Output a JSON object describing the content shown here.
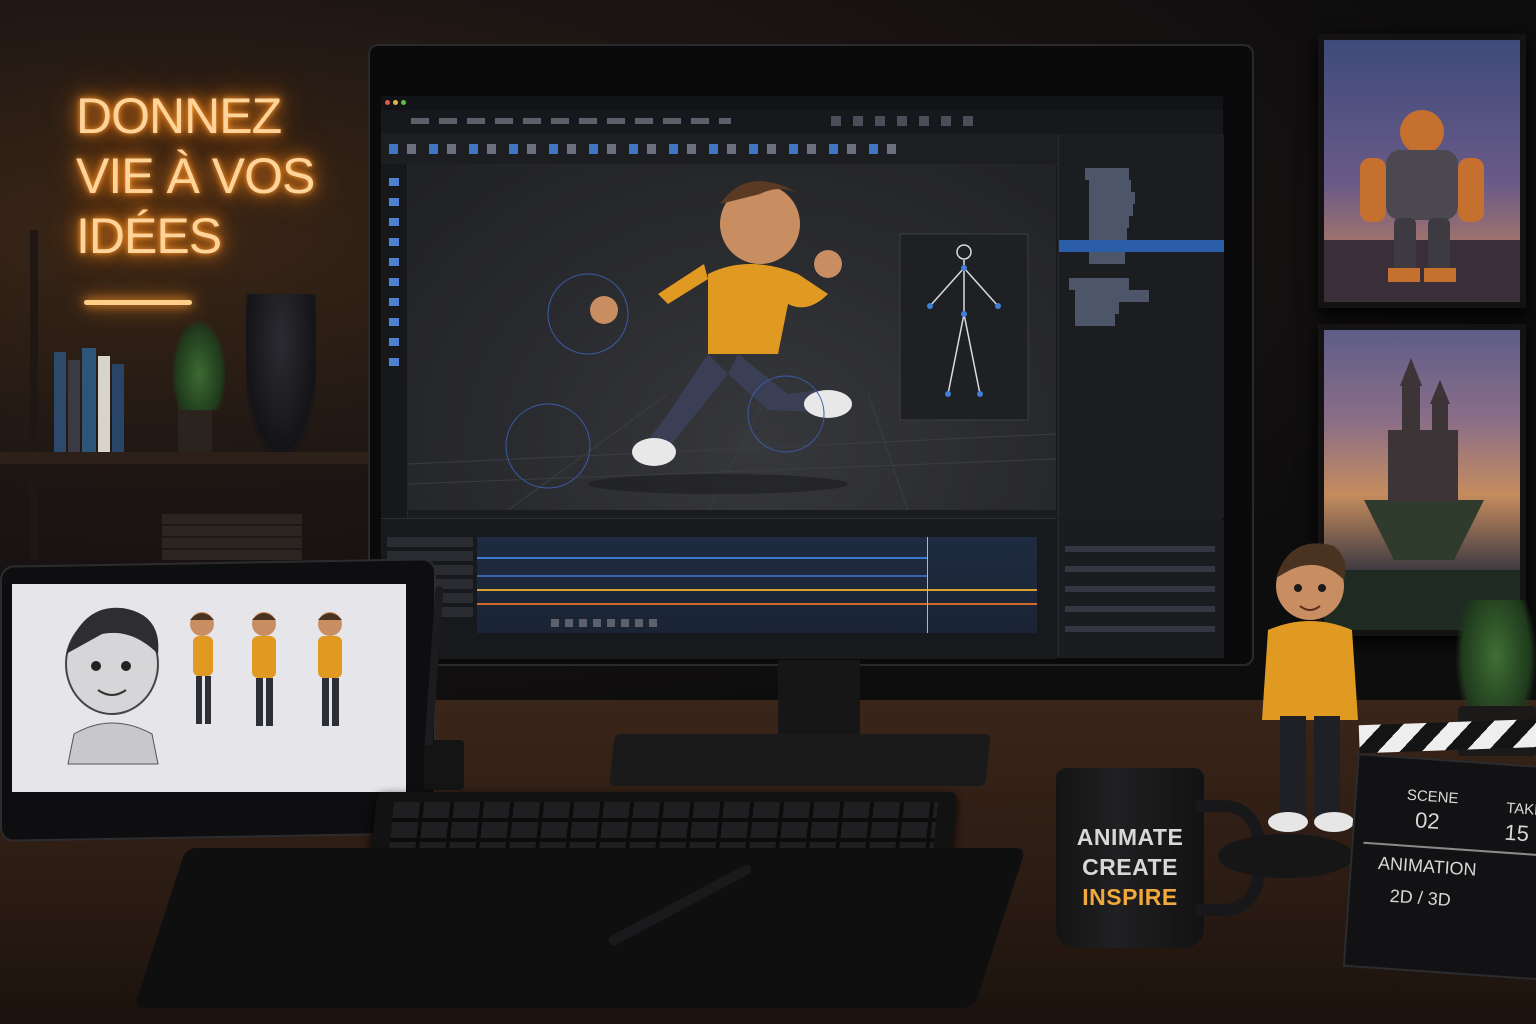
{
  "wall_sign": {
    "lines": [
      "DONNEZ",
      "VIE À VOS",
      "IDÉES"
    ]
  },
  "mug": {
    "lines": [
      "ANIMATE",
      "CREATE",
      "INSPIRE"
    ],
    "colors": {
      "main": "#d8d8d8",
      "accent": "#f2a93b"
    }
  },
  "clapperboard": {
    "scene_label": "SCENE",
    "scene_value": "02",
    "take_label": "TAKE",
    "take_value": "15",
    "title": "ANIMATION",
    "subtitle": "2D / 3D"
  },
  "software": {
    "accent": "#2b5ea8",
    "outliner_selected_index": 7
  },
  "colors": {
    "neon": "#ffd49a",
    "hoodie": "#e09a22",
    "desk": "#3a2519"
  }
}
